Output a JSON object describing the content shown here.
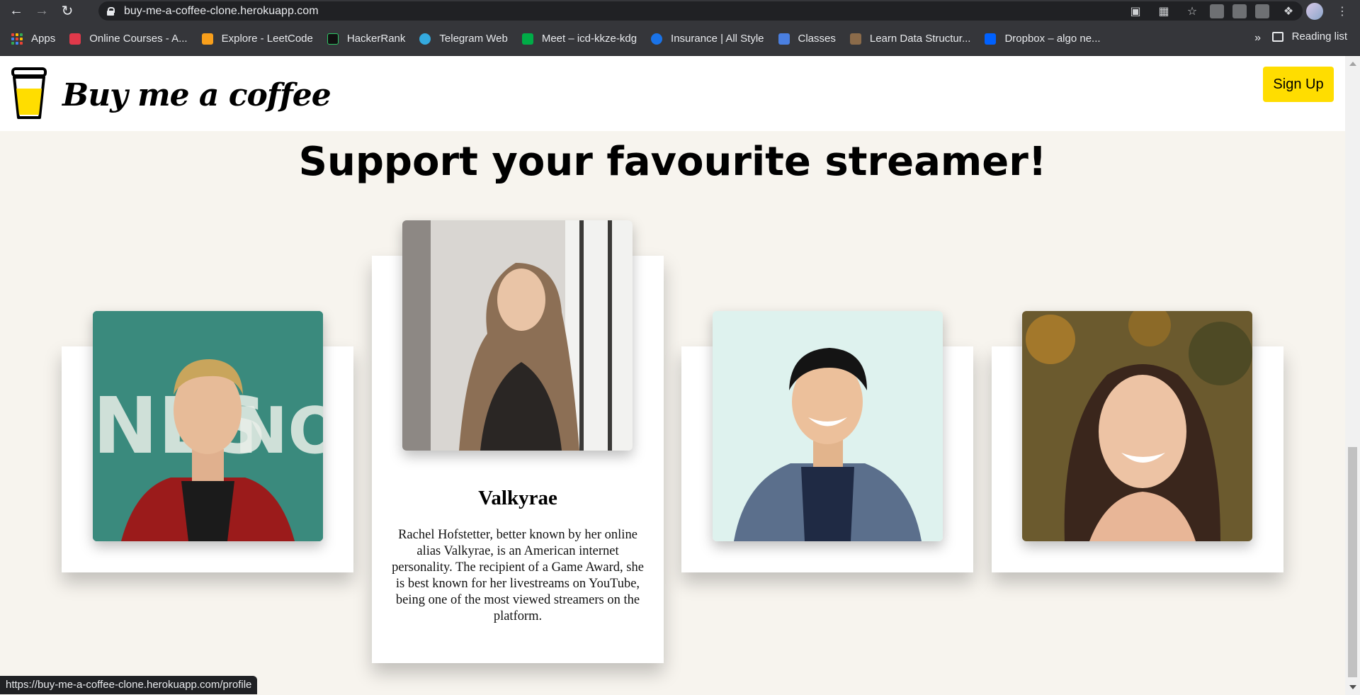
{
  "browser": {
    "url_host": "buy-me-a-coffee-clone.herokuapp.com",
    "bookmarks": [
      {
        "label": "Apps",
        "icon": "apps-grid-icon"
      },
      {
        "label": "Online Courses - A...",
        "icon": "udemy-icon",
        "color": "#e0394a"
      },
      {
        "label": "Explore - LeetCode",
        "icon": "leetcode-icon",
        "color": "#f89f1b"
      },
      {
        "label": "HackerRank",
        "icon": "hackerrank-icon",
        "color": "#111111"
      },
      {
        "label": "Telegram Web",
        "icon": "telegram-icon",
        "color": "#34aadf"
      },
      {
        "label": "Meet – icd-kkze-kdg",
        "icon": "google-meet-icon",
        "color": "#00ac47"
      },
      {
        "label": "Insurance | All Style",
        "icon": "insurance-icon",
        "color": "#1a73e8"
      },
      {
        "label": "Classes",
        "icon": "classroom-icon",
        "color": "#4a7fe0"
      },
      {
        "label": "Learn Data Structur...",
        "icon": "cc-icon",
        "color": "#8b6b4a"
      },
      {
        "label": "Dropbox – algo ne...",
        "icon": "dropbox-icon",
        "color": "#0061fe"
      }
    ],
    "more_label": "»",
    "reading_list_label": "Reading list",
    "status_url": "https://buy-me-a-coffee-clone.herokuapp.com/profile"
  },
  "header": {
    "brand": "Buy me a coffee",
    "signup_label": "Sign Up",
    "accent": "#ffdd00"
  },
  "hero": {
    "title": "Support your favourite streamer!"
  },
  "cards": [
    {
      "name": "",
      "description": "",
      "photo": "streamer-photo-1"
    },
    {
      "name": "Valkyrae",
      "description": "Rachel Hofstetter, better known by her online alias Valkyrae, is an American internet personality. The recipient of a Game Award, she is best known for her livestreams on YouTube, being one of the most viewed streamers on the platform.",
      "photo": "streamer-photo-2"
    },
    {
      "name": "",
      "description": "",
      "photo": "streamer-photo-3"
    },
    {
      "name": "",
      "description": "",
      "photo": "streamer-photo-4"
    }
  ]
}
